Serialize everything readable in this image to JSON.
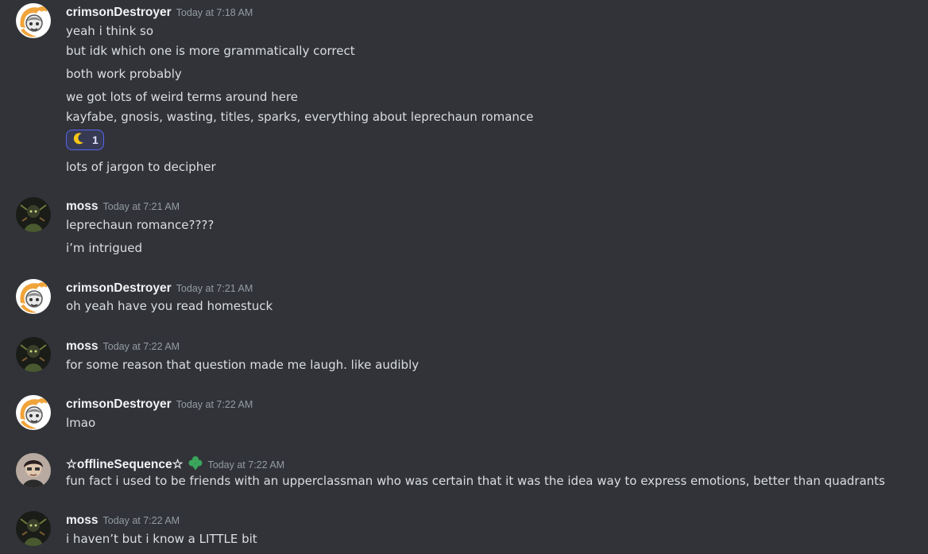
{
  "colors": {
    "background": "#313338",
    "text": "#dbdee1",
    "username": "#f2f3f5",
    "timestamp": "#949ba4",
    "reaction_border": "#5865f2",
    "reaction_bg": "#373a53"
  },
  "messages": [
    {
      "author": "crimsonDestroyer",
      "timestamp": "Today at 7:18 AM",
      "avatar_icon": "crimson-avatar",
      "lines": [
        "yeah i think so",
        "but idk which one is more grammatically correct",
        "both work probably",
        "we got lots of weird terms around here",
        "kayfabe, gnosis, wasting, titles, sparks, everything about leprechaun romance",
        "lots of jargon to decipher"
      ],
      "reaction": {
        "emoji": "crescent-moon-icon",
        "count": "1"
      }
    },
    {
      "author": "moss",
      "timestamp": "Today at 7:21 AM",
      "avatar_icon": "moss-avatar",
      "lines": [
        "leprechaun romance????",
        "i’m intrigued"
      ]
    },
    {
      "author": "crimsonDestroyer",
      "timestamp": "Today at 7:21 AM",
      "avatar_icon": "crimson-avatar",
      "lines": [
        "oh yeah have you read homestuck"
      ]
    },
    {
      "author": "moss",
      "timestamp": "Today at 7:22 AM",
      "avatar_icon": "moss-avatar",
      "lines": [
        "for some reason that question made me laugh. like audibly"
      ]
    },
    {
      "author": "crimsonDestroyer",
      "timestamp": "Today at 7:22 AM",
      "avatar_icon": "crimson-avatar",
      "lines": [
        "lmao"
      ]
    },
    {
      "author": "☆offlineSequence☆",
      "timestamp": "Today at 7:22 AM",
      "avatar_icon": "offline-avatar",
      "role_icon": "clover-icon",
      "lines": [
        "fun fact i used to be friends with an upperclassman who was certain that it was the idea way to express emotions, better than quadrants"
      ]
    },
    {
      "author": "moss",
      "timestamp": "Today at 7:22 AM",
      "avatar_icon": "moss-avatar",
      "lines": [
        "i haven’t but i know a LITTLE bit"
      ]
    }
  ]
}
